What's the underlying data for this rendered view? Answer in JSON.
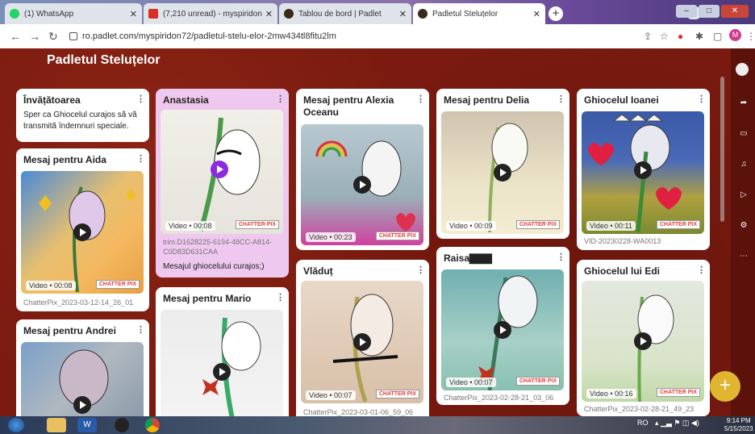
{
  "browser": {
    "tabs": [
      {
        "title": "(1) WhatsApp",
        "active": false
      },
      {
        "title": "(7,210 unread) - myspiridon72@",
        "active": false
      },
      {
        "title": "Tablou de bord | Padlet",
        "active": false
      },
      {
        "title": "Padletul Steluțelor",
        "active": true
      }
    ],
    "url": "ro.padlet.com/myspiridon72/padletul-stelu-elor-2mw434tl8fitu2lm",
    "profile_initial": "M",
    "window_controls": {
      "minimize": "–",
      "maximize": "□",
      "close": "✕"
    }
  },
  "page": {
    "title": "Padletul Steluțelor"
  },
  "cards": {
    "c1": {
      "title": "Învățătoarea",
      "body": "Sper ca Ghiocelul curajos să vă transmită îndemnuri speciale."
    },
    "c2": {
      "title": "Mesaj pentru Aida",
      "video": "Video • 00:08",
      "badge": "CHATTER PIX",
      "file": "ChatterPix_2023-03-12-14_26_01"
    },
    "c3": {
      "title": "Mesaj pentru Andrei"
    },
    "c4": {
      "title": "Anastasia",
      "video": "Video • 00:08",
      "badge": "CHATTER PIX",
      "file": "trim.D1628225-6194-48CC-A814-C0D83D631CAA",
      "body": "Mesajul ghiocelului curajos;)"
    },
    "c5": {
      "title": "Mesaj pentru Mario"
    },
    "c6": {
      "title": "Mesaj pentru Alexia Oceanu",
      "video": "Video • 00:23",
      "badge": "CHATTER PIX"
    },
    "c7": {
      "title": "Vlăduț",
      "video": "Video • 00:07",
      "badge": "CHATTER PIX",
      "file": "ChatterPix_2023-03-01-06_59_06"
    },
    "c8": {
      "title": "Mesaj pentru Delia",
      "video": "Video • 00:09",
      "badge": "CHATTER PIX"
    },
    "c9": {
      "title": "Raisa▇▇▇",
      "video": "Video • 00:07",
      "badge": "CHATTER PIX",
      "file": "ChatterPix_2023-02-28-21_03_06"
    },
    "c10": {
      "title": "Ghiocelul Ioanei",
      "video": "Video • 00:11",
      "badge": "CHATTER PIX",
      "file": "VID-20230228-WA0013"
    },
    "c11": {
      "title": "Ghiocelul lui Edi",
      "video": "Video • 00:16",
      "badge": "CHATTER PIX",
      "file": "ChatterPix_2023-02-28-21_49_23"
    }
  },
  "fab": {
    "label": "+"
  },
  "taskbar": {
    "lang": "RO",
    "time": "9:14 PM",
    "date": "5/15/2023"
  },
  "colors": {
    "page_bg": "#7a1a10",
    "card_purple": "#efc8ef",
    "fab": "#e0b630"
  },
  "icons": [
    "back-icon",
    "forward-icon",
    "reload-icon",
    "lock-icon",
    "share-icon",
    "star-icon",
    "extensions-icon",
    "play-icon",
    "more-icon",
    "gear-icon",
    "bell-icon"
  ]
}
